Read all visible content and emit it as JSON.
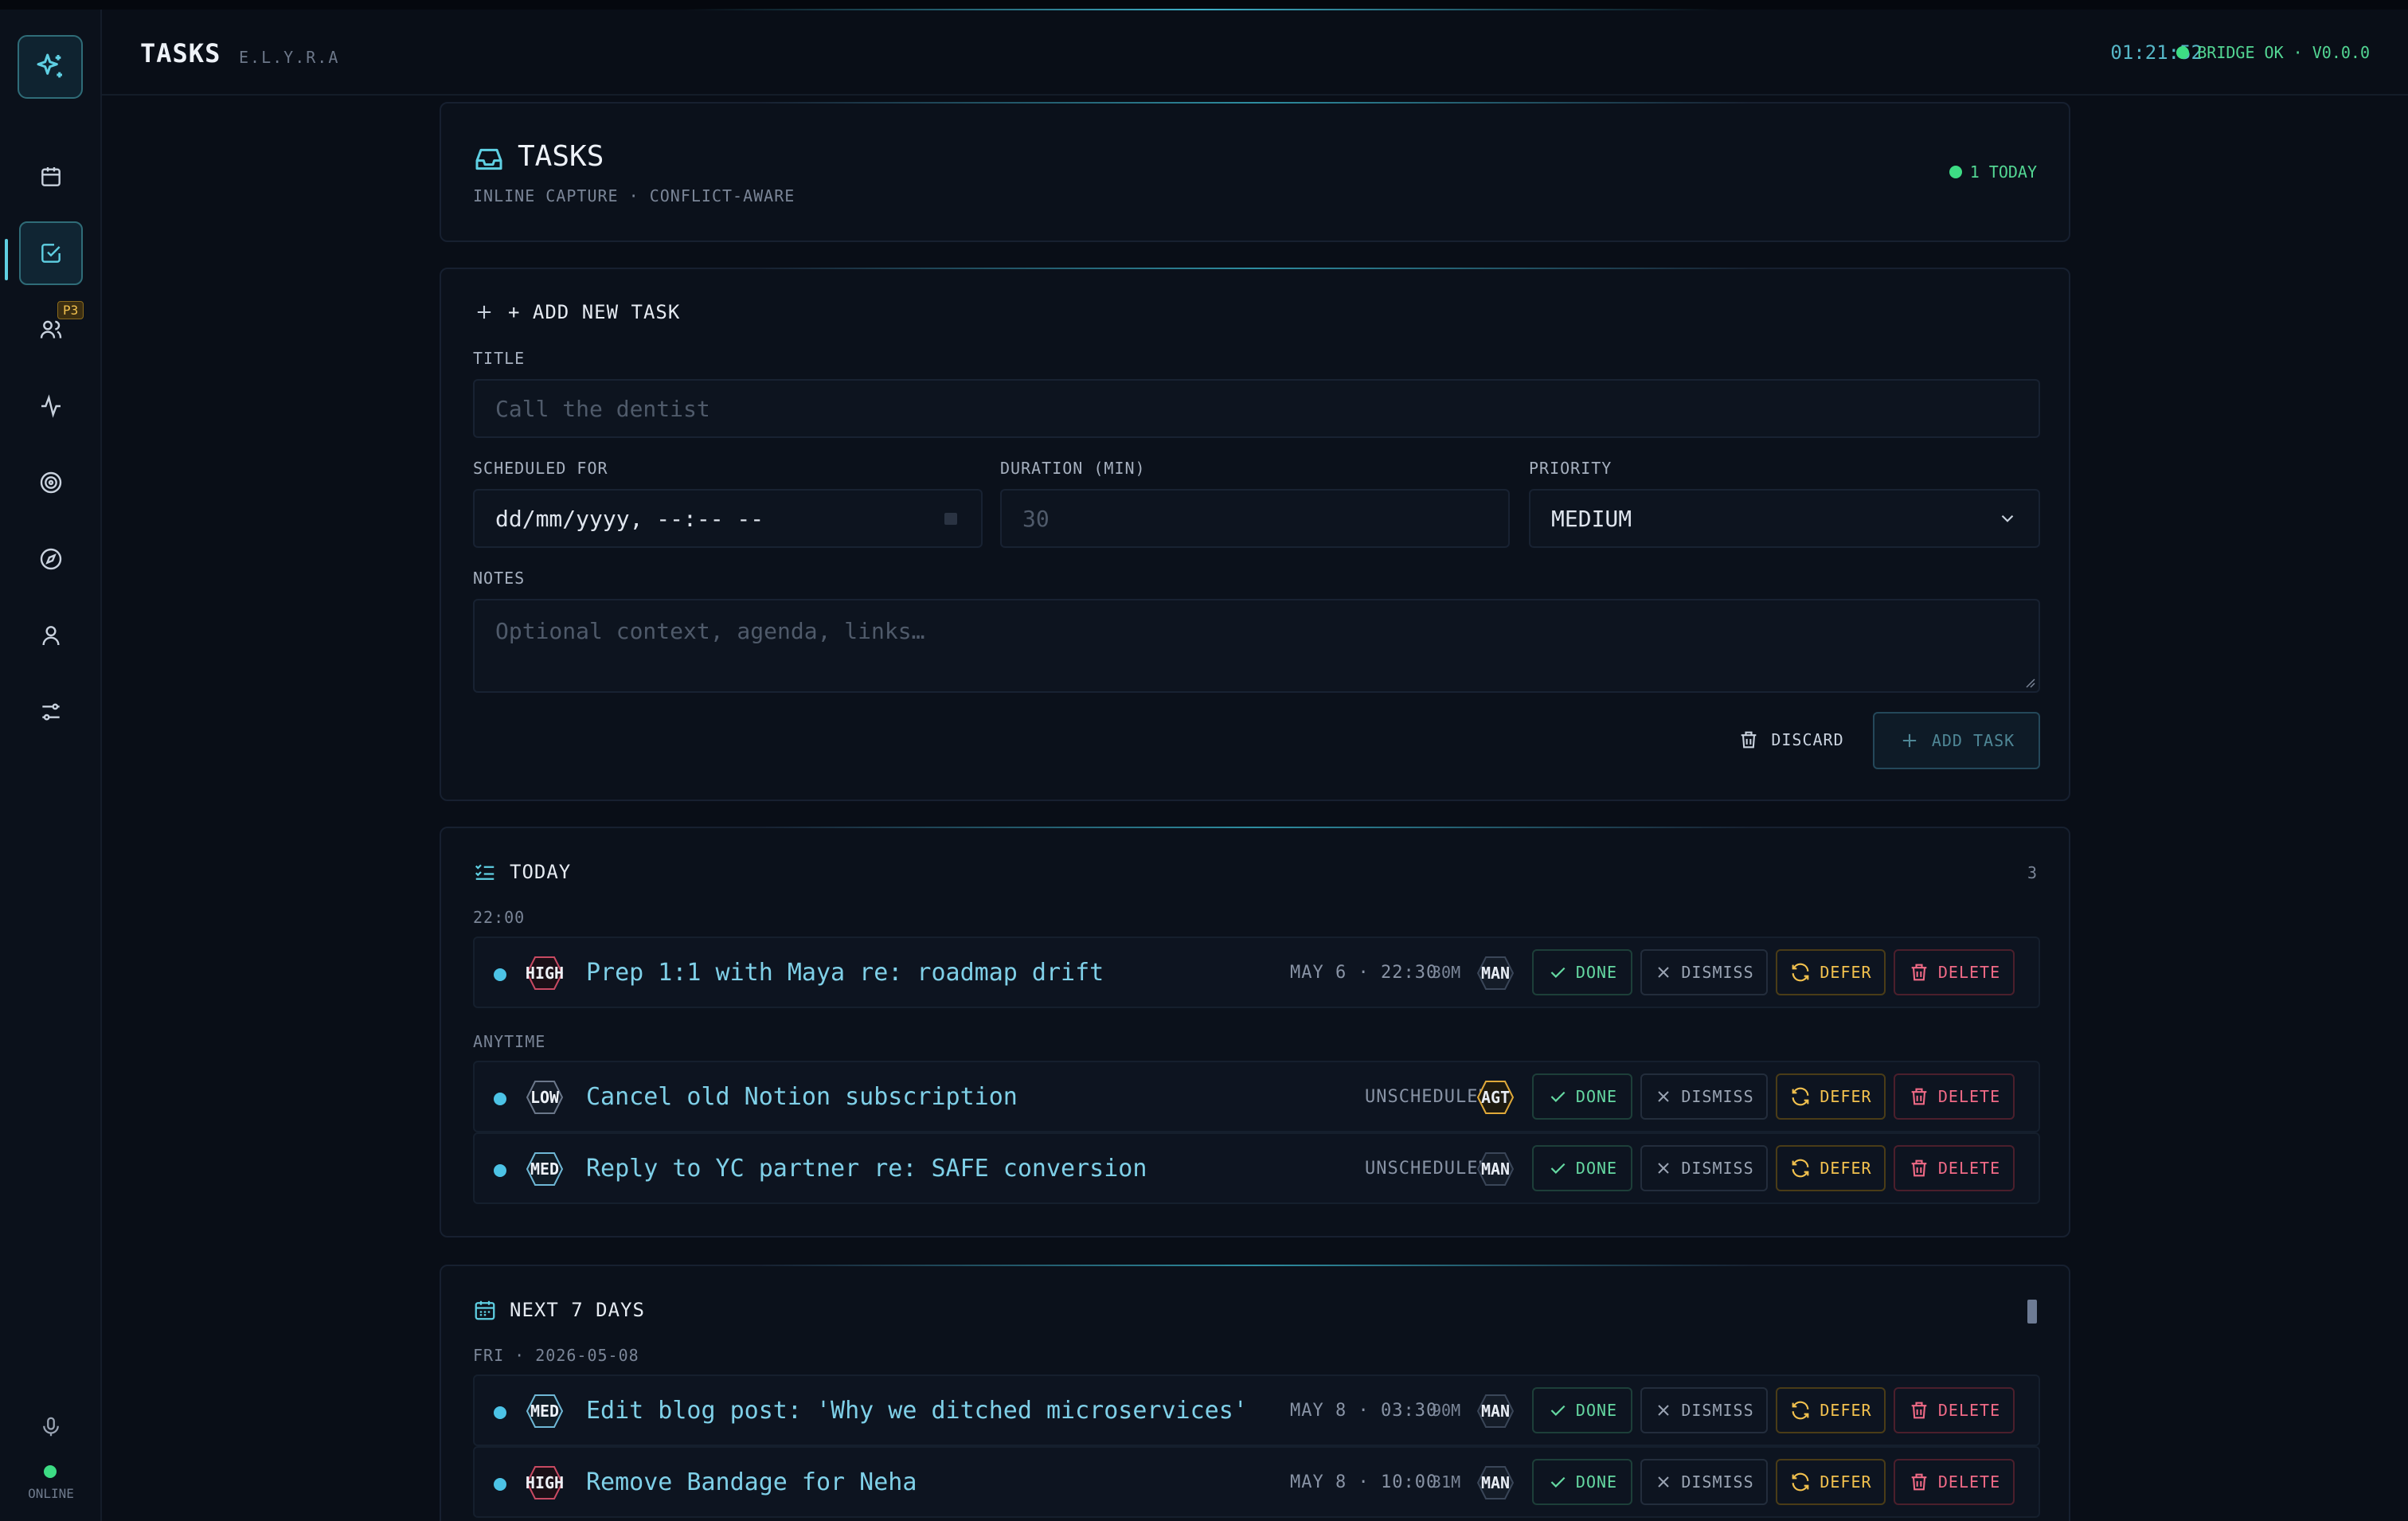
{
  "header": {
    "title": "TASKS",
    "subtitle": "E.L.Y.R.A",
    "clock": "01:21:52",
    "status": "BRIDGE OK · V0.0.0"
  },
  "sidebar": {
    "items": [
      {
        "icon": "calendar-icon"
      },
      {
        "icon": "check-square-icon",
        "active": true
      },
      {
        "icon": "users-icon",
        "badge": "P3"
      },
      {
        "icon": "activity-icon"
      },
      {
        "icon": "target-icon"
      },
      {
        "icon": "compass-icon"
      },
      {
        "icon": "user-icon"
      },
      {
        "icon": "sliders-icon"
      }
    ],
    "mic_icon": "microphone-icon",
    "status_label": "ONLINE"
  },
  "tasks_card": {
    "title": "TASKS",
    "subtitle": "INLINE CAPTURE · CONFLICT-AWARE",
    "today_badge": "1 TODAY"
  },
  "form": {
    "heading": "+ ADD NEW TASK",
    "title_label": "TITLE",
    "title_placeholder": "Call the dentist",
    "scheduled_label": "SCHEDULED FOR",
    "scheduled_value": "dd/mm/yyyy, --:-- --",
    "duration_label": "DURATION (MIN)",
    "duration_placeholder": "30",
    "priority_label": "PRIORITY",
    "priority_value": "MEDIUM",
    "notes_label": "NOTES",
    "notes_placeholder": "Optional context, agenda, links…",
    "discard_label": "DISCARD",
    "add_label": "ADD TASK"
  },
  "actions": {
    "done": "DONE",
    "dismiss": "DISMISS",
    "defer": "DEFER",
    "delete": "DELETE"
  },
  "today": {
    "title": "TODAY",
    "count": "3",
    "groups": [
      {
        "label": "22:00",
        "tasks": [
          {
            "priority": "HIGH",
            "title": "Prep 1:1 with Maya re: roadmap drift",
            "when": "MAY 6 · 22:30",
            "duration": "30M",
            "source": "MAN"
          }
        ]
      },
      {
        "label": "ANYTIME",
        "tasks": [
          {
            "priority": "LOW",
            "title": "Cancel old Notion subscription",
            "when": "UNSCHEDULED",
            "duration": "",
            "source": "AGT"
          },
          {
            "priority": "MED",
            "title": "Reply to YC partner re: SAFE conversion",
            "when": "UNSCHEDULED",
            "duration": "",
            "source": "MAN"
          }
        ]
      }
    ]
  },
  "next7": {
    "title": "NEXT 7 DAYS",
    "groups": [
      {
        "label": "FRI · 2026-05-08",
        "tasks": [
          {
            "priority": "MED",
            "title": "Edit blog post: 'Why we ditched microservices'",
            "when": "MAY 8 · 03:30",
            "duration": "90M",
            "source": "MAN"
          },
          {
            "priority": "HIGH",
            "title": "Remove Bandage for Neha",
            "when": "MAY 8 · 10:00",
            "duration": "31M",
            "source": "MAN"
          }
        ]
      }
    ]
  },
  "colors": {
    "accent": "#4cc3e6",
    "high": "#e0506a",
    "med": "#6fb8d6",
    "low": "#7f8ba0",
    "agent": "#e0a93a",
    "ok": "#3ddc84"
  }
}
